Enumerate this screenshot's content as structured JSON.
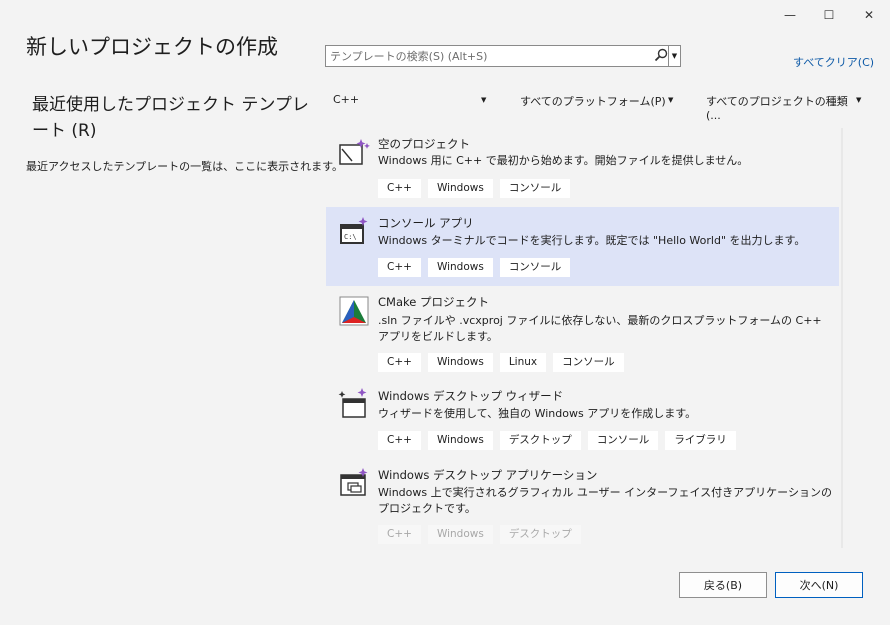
{
  "window": {
    "title": "新しいプロジェクトの作成",
    "minimize_label": "—",
    "maximize_label": "☐",
    "close_label": "✕"
  },
  "left": {
    "recent_title": "最近使用したプロジェクト テンプレート (R)",
    "recent_desc": "最近アクセスしたテンプレートの一覧は、ここに表示されます。"
  },
  "search": {
    "placeholder": "テンプレートの検索(S) (Alt+S)",
    "clear_all": "すべてクリア(C)"
  },
  "filters": {
    "language": "C++",
    "platform": "すべてのプラットフォーム(P)",
    "project_type": "すべてのプロジェクトの種類(..."
  },
  "templates": [
    {
      "title": "空のプロジェクト",
      "desc": "Windows 用に C++ で最初から始めます。開始ファイルを提供しません。",
      "tags": [
        "C++",
        "Windows",
        "コンソール"
      ]
    },
    {
      "title": "コンソール アプリ",
      "desc": "Windows ターミナルでコードを実行します。既定では \"Hello World\" を出力します。",
      "tags": [
        "C++",
        "Windows",
        "コンソール"
      ]
    },
    {
      "title": "CMake プロジェクト",
      "desc": ".sln ファイルや .vcxproj ファイルに依存しない、最新のクロスプラットフォームの C++ アプリをビルドします。",
      "tags": [
        "C++",
        "Windows",
        "Linux",
        "コンソール"
      ]
    },
    {
      "title": "Windows デスクトップ ウィザード",
      "desc": "ウィザードを使用して、独自の Windows アプリを作成します。",
      "tags": [
        "C++",
        "Windows",
        "デスクトップ",
        "コンソール",
        "ライブラリ"
      ]
    },
    {
      "title": "Windows デスクトップ アプリケーション",
      "desc": "Windows 上で実行されるグラフィカル ユーザー インターフェイス付きアプリケーションのプロジェクトです。",
      "tags": [
        "C++",
        "Windows",
        "デスクトップ"
      ]
    }
  ],
  "buttons": {
    "back": "戻る(B)",
    "next": "次へ(N)"
  }
}
